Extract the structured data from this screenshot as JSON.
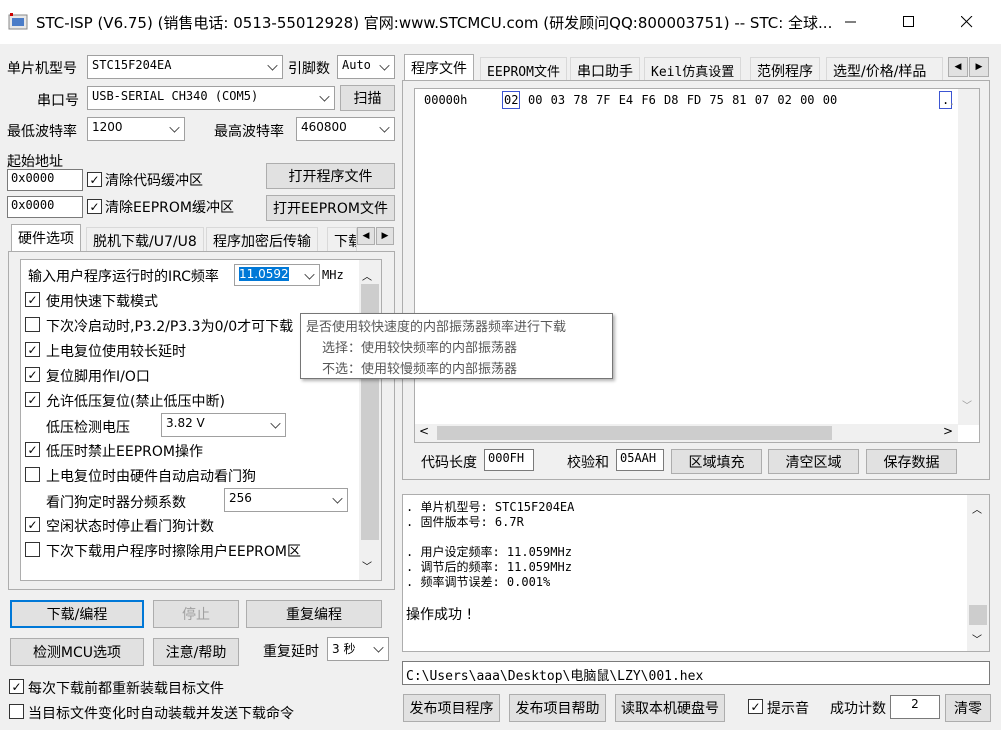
{
  "window": {
    "title": "STC-ISP (V6.75) (销售电话: 0513-55012928) 官网:www.STCMCU.com  (研发顾问QQ:800003751)  -- STC: 全球..."
  },
  "left": {
    "mcu_label": "单片机型号",
    "mcu_value": "STC15F204EA",
    "pins_label": "引脚数",
    "pins_value": "Auto",
    "port_label": "串口号",
    "port_value": "USB-SERIAL CH340 (COM5)",
    "scan_label": "扫描",
    "min_baud_label": "最低波特率",
    "min_baud_value": "1200",
    "max_baud_label": "最高波特率",
    "max_baud_value": "460800",
    "start_addr_label": "起始地址",
    "addr1": "0x0000",
    "clear_code": "清除代码缓冲区",
    "open_prog": "打开程序文件",
    "addr2": "0x0000",
    "clear_eeprom": "清除EEPROM缓冲区",
    "open_eeprom": "打开EEPROM文件",
    "tabs": [
      "硬件选项",
      "脱机下载/U7/U8",
      "程序加密后传输",
      "下载"
    ],
    "irc_label": "输入用户程序运行时的IRC频率",
    "irc_value": "11.0592",
    "irc_unit": "MHz",
    "options": [
      "使用快速下载模式",
      "下次冷启动时,P3.2/P3.3为0/0才可下载",
      "上电复位使用较长延时",
      "复位脚用作I/O口",
      "允许低压复位(禁止低压中断)"
    ],
    "lv_label": "低压检测电压",
    "lv_value": "3.82 V",
    "options2": [
      "低压时禁止EEPROM操作",
      "上电复位时由硬件自动启动看门狗"
    ],
    "wdt_label": "看门狗定时器分频系数",
    "wdt_value": "256",
    "options3": [
      "空闲状态时停止看门狗计数",
      "下次下载用户程序时擦除用户EEPROM区"
    ],
    "download": "下载/编程",
    "stop": "停止",
    "reprog": "重复编程",
    "check": "检测MCU选项",
    "help": "注意/帮助",
    "delay_label": "重复延时",
    "delay_value": "3 秒",
    "reload": "每次下载前都重新装载目标文件",
    "autosend": "当目标文件变化时自动装载并发送下载命令"
  },
  "tooltip": {
    "line1": "是否使用较快速度的内部振荡器频率进行下载",
    "line2": "选择：使用较快频率的内部振荡器",
    "line3": "不选：使用较慢频率的内部振荡器"
  },
  "right": {
    "tabs": [
      "程序文件",
      "EEPROM文件",
      "串口助手",
      "Keil仿真设置",
      "范例程序",
      "选型/价格/样品"
    ],
    "hex_addr": "00000h",
    "hex_first": "02",
    "hex_rest": "00 03 78 7F E4 F6 D8 FD 75 81 07 02 00 00",
    "hex_ascii": ".",
    "code_len_label": "代码长度",
    "code_len": "000FH",
    "checksum_label": "校验和",
    "checksum": "05AAH",
    "fill": "区域填充",
    "clear": "清空区域",
    "save": "保存数据",
    "log": [
      ". 单片机型号: STC15F204EA",
      ". 固件版本号: 6.7R",
      "",
      ". 用户设定频率: 11.059MHz",
      ". 调节后的频率: 11.059MHz",
      ". 频率调节误差: 0.001%",
      "",
      "操作成功 !"
    ],
    "path": "C:\\Users\\aaa\\Desktop\\电脑鼠\\LZY\\001.hex",
    "pub_prog": "发布项目程序",
    "pub_help": "发布项目帮助",
    "read_disk": "读取本机硬盘号",
    "prompt_sound": "提示音",
    "success_label": "成功计数",
    "success_value": "2",
    "clear_btn": "清零"
  }
}
